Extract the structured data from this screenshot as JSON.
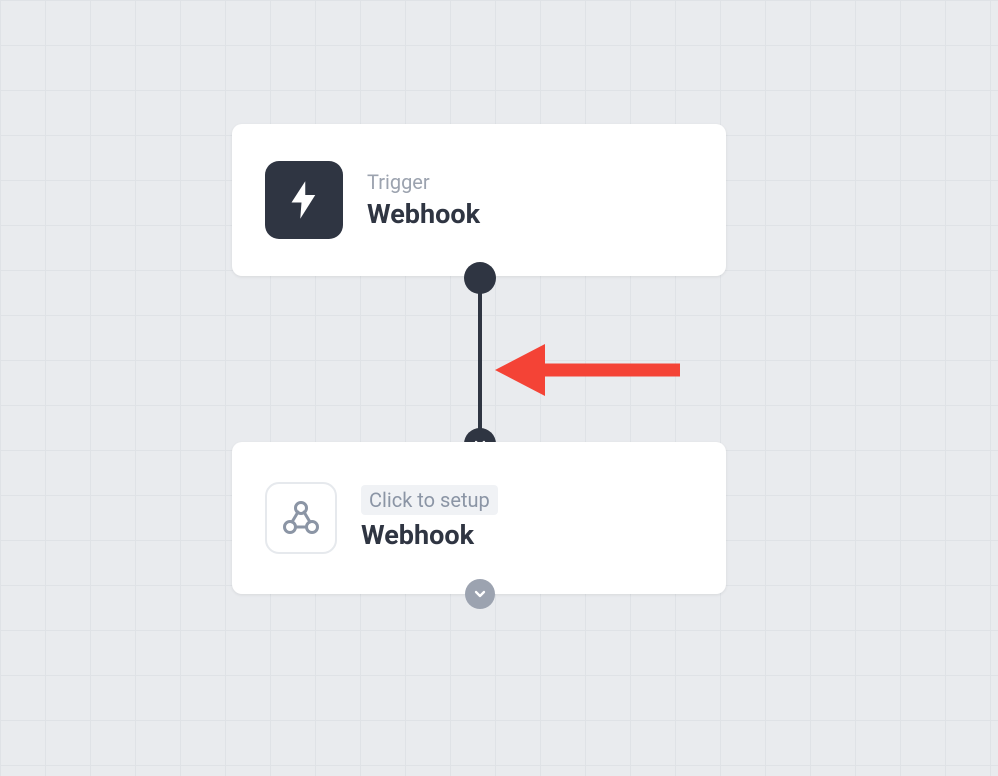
{
  "nodes": {
    "trigger": {
      "label": "Trigger",
      "title": "Webhook",
      "icon": "lightning-icon"
    },
    "action": {
      "label": "Click to setup",
      "title": "Webhook",
      "icon": "webhook-icon"
    }
  },
  "colors": {
    "node_bg": "#ffffff",
    "dark_icon_bg": "#2f3542",
    "connector": "#2f3542",
    "grid_bg": "#e9ebee",
    "grid_line": "#dfe2e6",
    "label_text": "#9ca3af",
    "title_text": "#2f3542",
    "badge_bg": "#f0f2f5",
    "add_button": "#9ca3b0",
    "annotation_arrow": "#f44336"
  }
}
